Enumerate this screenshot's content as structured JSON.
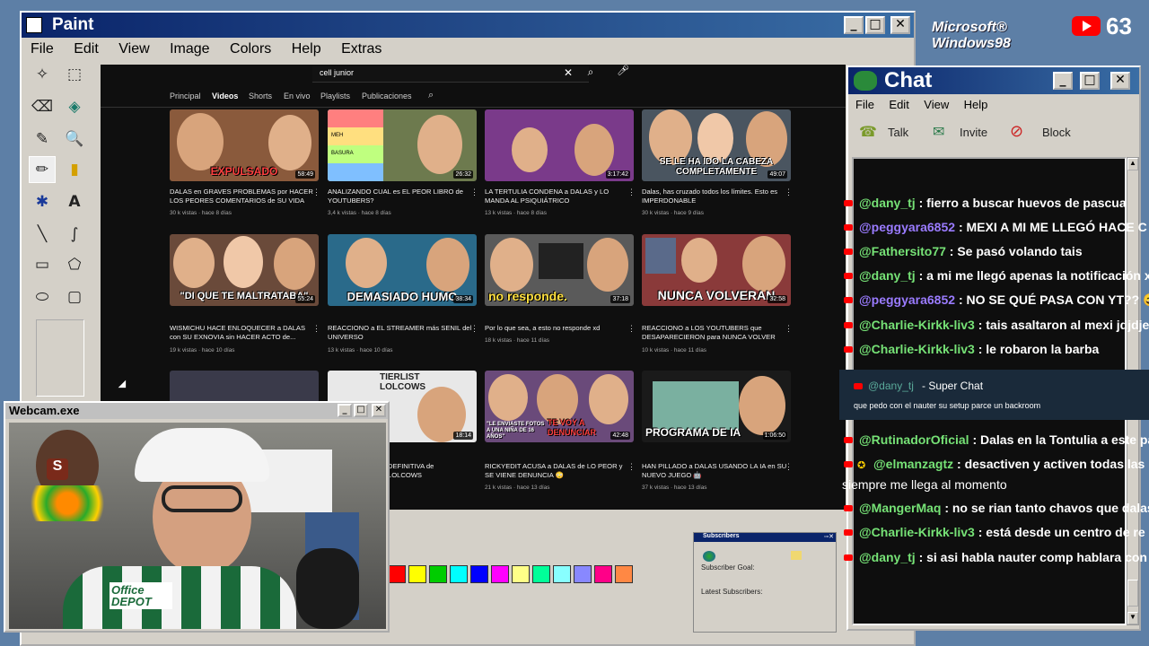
{
  "desktop": {
    "windows98_logo": "Microsoft® Windows98",
    "youtube_count": "63"
  },
  "paint": {
    "title": "Paint",
    "menu": [
      "File",
      "Edit",
      "View",
      "Image",
      "Colors",
      "Help",
      "Extras"
    ],
    "palette_colors": [
      "#ff0000",
      "#ffff00",
      "#00cc00",
      "#00ffff",
      "#0000ff",
      "#ff00ff",
      "#ffff88",
      "#00ff99",
      "#88ffff",
      "#8888ff",
      "#ff0088",
      "#ff8844"
    ]
  },
  "youtube": {
    "search_value": "cell junior",
    "tabs": [
      "Principal",
      "Videos",
      "Shorts",
      "En vivo",
      "Playlists",
      "Publicaciones"
    ],
    "active_tab": "Videos",
    "videos": [
      {
        "caption": "EXPULSADO",
        "duration": "58:49",
        "title": "DALAS en GRAVES PROBLEMAS por HACER LOS PEORES COMENTARIOS de SU VIDA",
        "meta": "30 k vistas · hace 8 días",
        "bg": "#8a5a3c"
      },
      {
        "caption": "",
        "duration": "26:32",
        "title": "ANALIZANDO CUAL es EL PEOR LIBRO de YOUTUBERS?",
        "meta": "3,4 k vistas · hace 8 días",
        "bg": "#6d7a4e",
        "tier": [
          "MEH",
          "BASURA"
        ]
      },
      {
        "caption": "",
        "duration": "3:17:42",
        "title": "LA TERTULIA CONDENA a DALAS y LO MANDA AL PSIQUIÁTRICO",
        "meta": "13 k vistas · hace 8 días",
        "bg": "#7a3a8a"
      },
      {
        "caption": "SE LE HA IDO LA CABEZA COMPLETAMENTE",
        "duration": "49:07",
        "title": "Dalas, has cruzado todos los límites. Esto es IMPERDONABLE",
        "meta": "30 k vistas · hace 9 días",
        "bg": "#4a5560"
      },
      {
        "caption": "\"DI QUE TE MALTRATABA\"",
        "duration": "55:24",
        "title": "WISMICHU HACE ENLOQUECER a DALAS con SU EXNOVIA sin HACER ACTO de...",
        "meta": "19 k vistas · hace 10 días",
        "bg": "#6a4a3a"
      },
      {
        "caption": "DEMASIADO HUMO",
        "duration": "38:34",
        "title": "REACCIONO a EL STREAMER más SENIL del UNIVERSO",
        "meta": "13 k vistas · hace 10 días",
        "bg": "#2a6a8a"
      },
      {
        "caption": "no responde.",
        "duration": "37:18",
        "title": "Por lo que sea, a esto no responde xd",
        "meta": "18 k vistas · hace 11 días",
        "bg": "#5a5a5a"
      },
      {
        "caption": "NUNCA VOLVERAN",
        "duration": "32:58",
        "title": "REACCIONO a LOS YOUTUBERS que DESAPARECIERON para NUNCA VOLVER",
        "meta": "10 k vistas · hace 11 días",
        "bg": "#8a3a3a"
      },
      {
        "caption": "",
        "duration": "",
        "title": "",
        "meta": "",
        "bg": "#3a3a4a"
      },
      {
        "caption": "TIERLIST LOLCOWS",
        "duration": "18:14",
        "title": "DEFINITIVA de LOLCOWS",
        "meta": "",
        "bg": "#e8e8e8"
      },
      {
        "caption": "TE VOY A DENUNCIAR",
        "duration": "42:48",
        "title": "RICKYEDIT ACUSA a DALAS de LO PEOR y SE VIENE DENUNCIA 😳",
        "meta": "21 k vistas · hace 13 días",
        "bg": "#6a4a7a",
        "sub": "\"LE ENVIASTE FOTOS A UNA NIÑA DE 16 AÑOS\""
      },
      {
        "caption": "PROGRAMA DE IA",
        "duration": "1:06:50",
        "title": "HAN PILLADO a DALAS USANDO LA IA en SU NUEVO JUEGO 🤖",
        "meta": "37 k vistas · hace 13 días",
        "bg": "#5a8a7a"
      }
    ]
  },
  "webcam": {
    "title": "Webcam.exe",
    "jersey_text": "Office DEPOT",
    "cap_text": "S"
  },
  "chat": {
    "title": "Chat",
    "menu": [
      "File",
      "Edit",
      "View",
      "Help"
    ],
    "toolbar": [
      "Talk",
      "Invite",
      "Block"
    ],
    "messages": [
      {
        "user": "@dany_tj",
        "text": ": fierro a buscar huevos de pascua"
      },
      {
        "user": "@peggyara6852",
        "text": ": MEXI A MI ME LLEGÓ HACE C",
        "alt": true
      },
      {
        "user": "@Fathersito77",
        "text": ": Se pasó volando tais"
      },
      {
        "user": "@dany_tj",
        "text": ": a mi me llegó apenas la notificación x"
      },
      {
        "user": "@peggyara6852",
        "text": ": NO SE QUÉ PASA CON YT?? 😅",
        "alt": true
      },
      {
        "user": "@Charlie-Kirkk-liv3",
        "text": ": tais asaltaron al mexi jdjdje"
      },
      {
        "user": "@Charlie-Kirkk-liv3",
        "text": ": le robaron la barba"
      }
    ],
    "superchat": {
      "user": "@dany_tj",
      "label": "- Super Chat",
      "text": "que pedo con el nauter su setup parce un backroom"
    },
    "messages2": [
      {
        "user": "@RutinadorOficial",
        "text": ": Dalas en la Tontulia a este pa"
      },
      {
        "user": "@elmanzagtz",
        "text": ": desactiven y activen todas las",
        "cont": "siempre me llega al momento"
      },
      {
        "user": "@MangerMaq",
        "text": ": no se rian tanto chavos que dalas"
      },
      {
        "user": "@Charlie-Kirkk-liv3",
        "text": ": está desde un centro de re"
      },
      {
        "user": "@dany_tj",
        "text": ": si asi habla nauter comp hablara con"
      }
    ]
  },
  "subscribers": {
    "title": "Subscribers",
    "goal_label": "Subscriber Goal:",
    "latest_label": "Latest Subscribers:"
  }
}
